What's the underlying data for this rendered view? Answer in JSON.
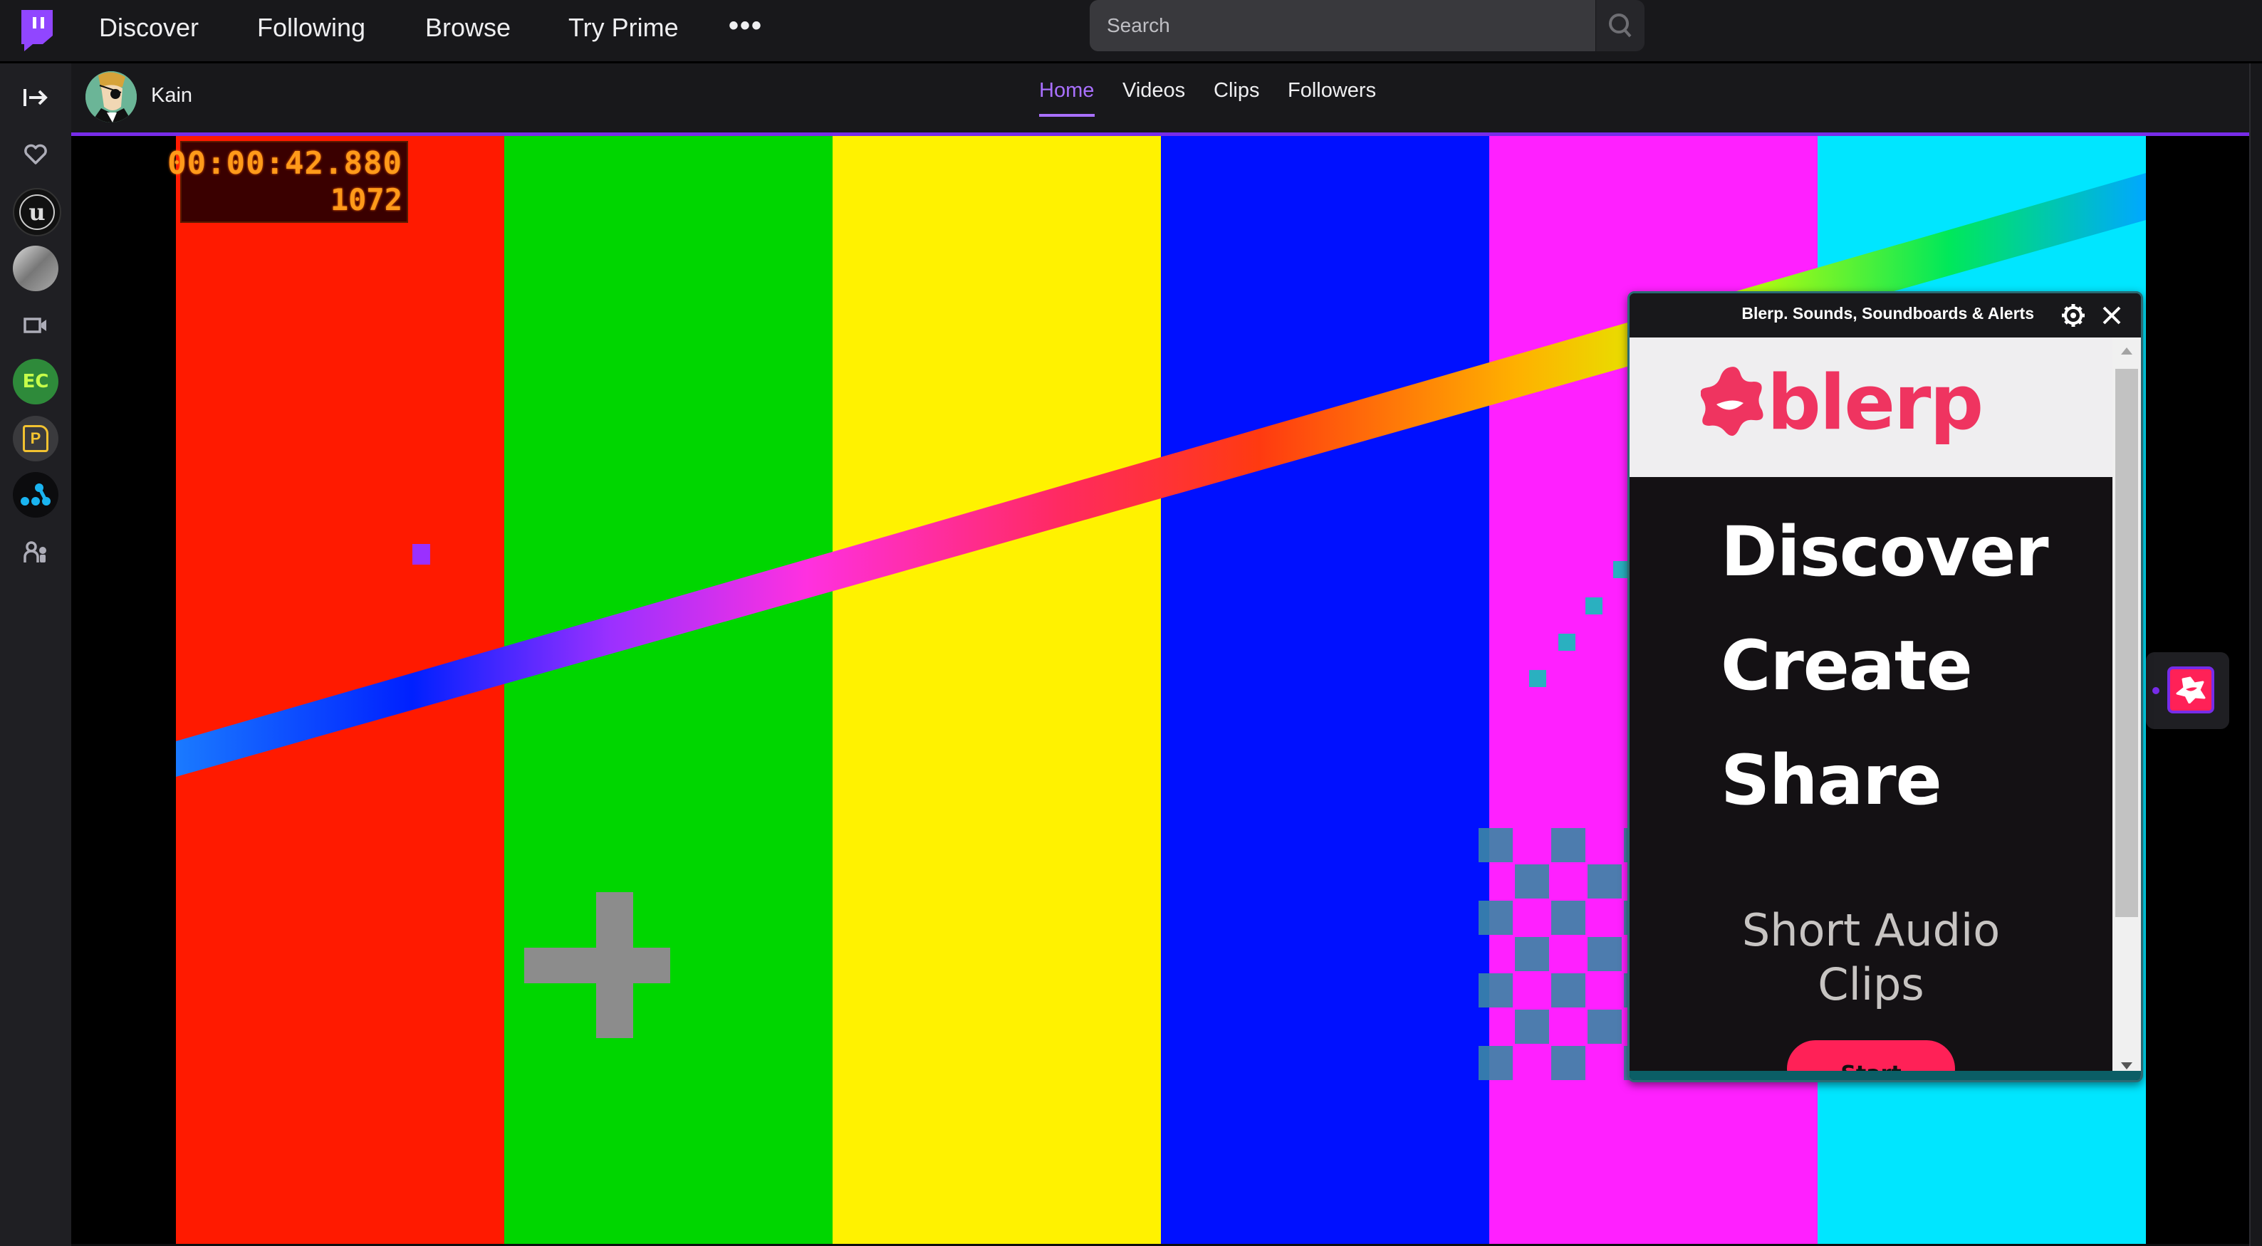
{
  "topnav": {
    "logo_icon": "twitch-logo-icon",
    "links": [
      "Discover",
      "Following",
      "Browse",
      "Try Prime"
    ],
    "more_label": "•••",
    "search_placeholder": "Search",
    "search_icon": "search-icon"
  },
  "sidebar": {
    "items": [
      {
        "name": "expand-sidebar-icon"
      },
      {
        "name": "followed-heart-icon"
      },
      {
        "name": "channel-unreal-engine",
        "label": "U"
      },
      {
        "name": "channel-gray-photo"
      },
      {
        "name": "video-camera-icon"
      },
      {
        "name": "channel-ec",
        "label": "EC"
      },
      {
        "name": "channel-p",
        "label": "P"
      },
      {
        "name": "channel-dots"
      },
      {
        "name": "recommended-users-icon"
      }
    ]
  },
  "channel": {
    "name": "Kain",
    "tabs": [
      "Home",
      "Videos",
      "Clips",
      "Followers"
    ],
    "active_tab": "Home"
  },
  "video": {
    "timer_time": "00:00:42.880",
    "timer_frame": "1072",
    "bar_colors": [
      "#ff1a00",
      "#00d600",
      "#fff200",
      "#0010ff",
      "#ff20ff",
      "#00e6ff"
    ]
  },
  "blerp": {
    "title": "Blerp. Sounds, Soundboards & Alerts",
    "logo_text": "blerp",
    "headlines": [
      "Discover",
      "Create",
      "Share"
    ],
    "subtitle_line1": "Short Audio",
    "subtitle_line2": "Clips",
    "start_label": "Start",
    "accent": "#ff2157"
  },
  "colors": {
    "twitch_purple": "#772ce8",
    "active_tab": "#a970ff"
  }
}
